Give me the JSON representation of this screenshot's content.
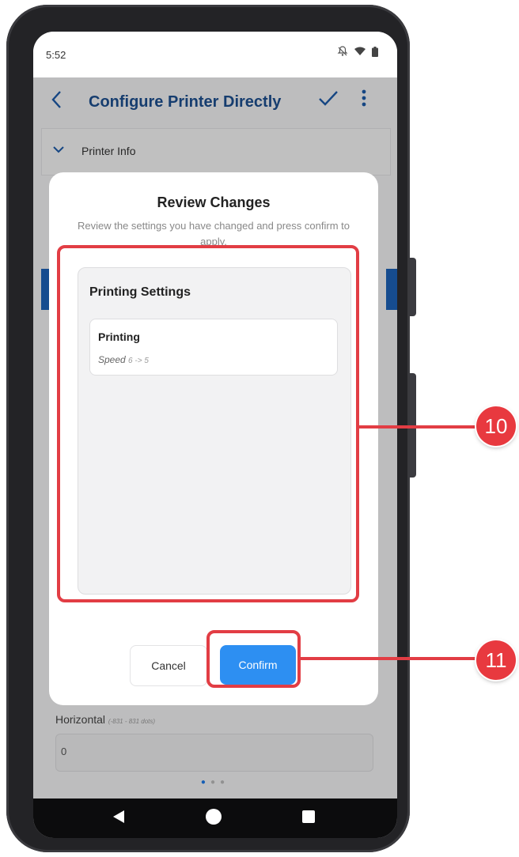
{
  "status_bar": {
    "time": "5:52",
    "icons": [
      "notifications-off-icon",
      "wifi-icon",
      "battery-icon"
    ]
  },
  "app_bar": {
    "title": "Configure Printer Directly",
    "icons": [
      "back-arrow-icon",
      "check-icon",
      "more-vert-icon"
    ]
  },
  "section": {
    "label": "Printer Info"
  },
  "dialog": {
    "title": "Review Changes",
    "subtitle": "Review the settings you have changed and press confirm to apply.",
    "panel_title": "Printing Settings",
    "changes": [
      {
        "name": "Printing",
        "field": "Speed",
        "value": "6 -> 5"
      }
    ],
    "cancel_label": "Cancel",
    "confirm_label": "Confirm"
  },
  "background_field": {
    "label": "Horizontal",
    "hint": "(-831 - 831 dots)",
    "value": "0"
  },
  "pagination": {
    "total": 3,
    "active": 1
  },
  "callouts": [
    {
      "number": "10"
    },
    {
      "number": "11"
    }
  ],
  "colors": {
    "accent": "#2d8ff2",
    "title_blue": "#1d4f8f",
    "callout_red": "#e23d44"
  }
}
